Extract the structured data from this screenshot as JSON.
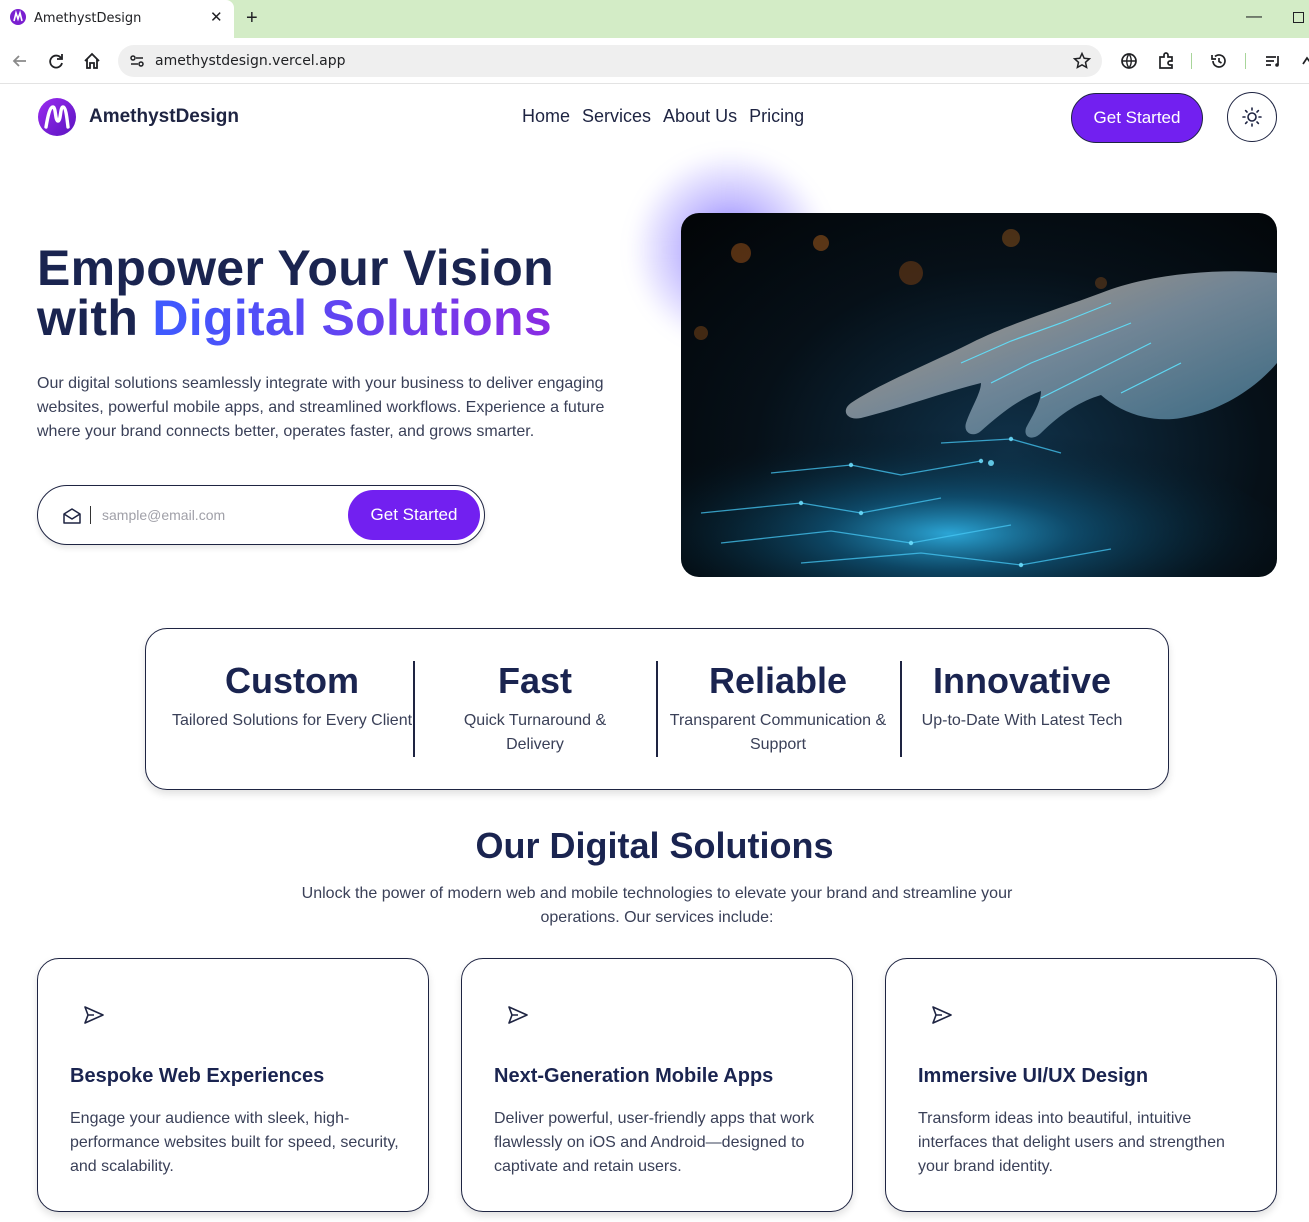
{
  "browser": {
    "tab_title": "AmethystDesign",
    "url": "amethystdesign.vercel.app"
  },
  "nav": {
    "brand": "AmethystDesign",
    "links": [
      "Home",
      "Services",
      "About Us",
      "Pricing"
    ],
    "cta": "Get Started",
    "theme_icon": "sun-icon"
  },
  "hero": {
    "title_line1": "Empower Your Vision",
    "title_line2_plain": "with",
    "title_line2_highlight": "Digital Solutions",
    "description": "Our digital solutions seamlessly integrate with your business to deliver engaging websites, powerful mobile apps, and streamlined workflows. Experience a future where your brand connects better, operates faster, and grows smarter.",
    "email_placeholder": "sample@email.com",
    "email_button": "Get Started"
  },
  "features": [
    {
      "title": "Custom",
      "desc": "Tailored Solutions for Every Client"
    },
    {
      "title": "Fast",
      "desc": "Quick Turnaround & Delivery"
    },
    {
      "title": "Reliable",
      "desc": "Transparent Communication & Support"
    },
    {
      "title": "Innovative",
      "desc": "Up-to-Date With Latest Tech"
    }
  ],
  "solutions": {
    "title": "Our Digital Solutions",
    "subtitle": "Unlock the power of modern web and mobile technologies to elevate your brand and streamline your operations. Our services include:",
    "cards": [
      {
        "icon": "send-icon",
        "title": "Bespoke Web Experiences",
        "desc": "Engage your audience with sleek, high-performance websites built for speed, security, and scalability."
      },
      {
        "icon": "send-icon",
        "title": "Next-Generation Mobile Apps",
        "desc": "Deliver powerful, user-friendly apps that work flawlessly on iOS and Android—designed to captivate and retain users."
      },
      {
        "icon": "send-icon",
        "title": "Immersive UI/UX Design",
        "desc": "Transform ideas into beautiful, intuitive interfaces that delight users and strengthen your brand identity."
      }
    ]
  },
  "colors": {
    "accent": "#7220f0",
    "navy": "#1a2450",
    "gradient_start": "#3d5bff",
    "gradient_end": "#8a2be2",
    "browser_frame": "#d3ecc6"
  }
}
